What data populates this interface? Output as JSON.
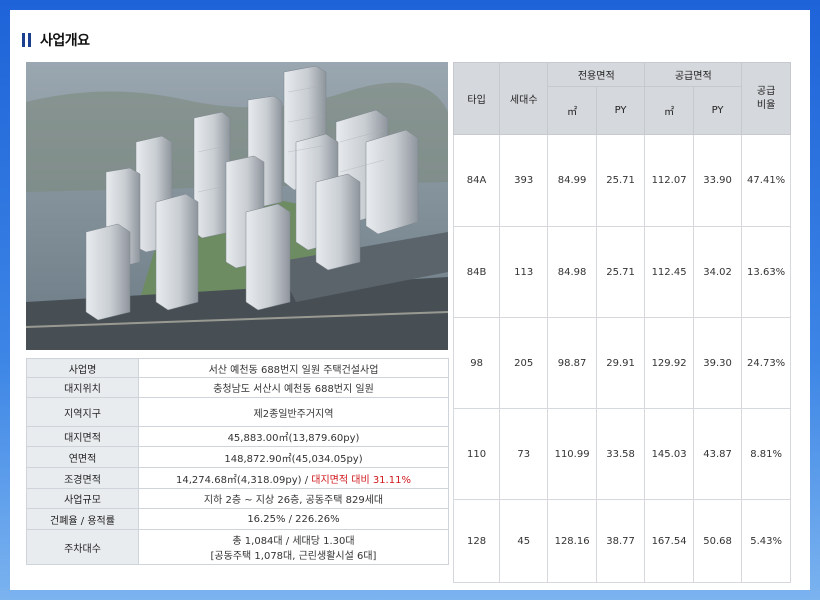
{
  "section": {
    "title": "사업개요"
  },
  "info_rows": [
    {
      "label": "사업명",
      "value": "서산 예천동 688번지 일원 주택건설사업"
    },
    {
      "label": "대지위치",
      "value": "충청남도 서산시 예천동 688번지 일원"
    },
    {
      "label": "지역지구",
      "value": "제2종일반주거지역"
    },
    {
      "label": "대지면적",
      "value": "45,883.00㎡(13,879.60py)"
    },
    {
      "label": "연면적",
      "value": "148,872.90㎡(45,034.05py)"
    },
    {
      "label": "조경면적",
      "value": "14,274.68㎡(4,318.09py) / ",
      "highlight": "대지면적 대비 31.11%"
    },
    {
      "label": "사업규모",
      "value": "지하 2층 ~ 지상 26층, 공동주택 829세대"
    },
    {
      "label": "건폐율 / 용적률",
      "value": "16.25% / 226.26%"
    },
    {
      "label": "주차대수",
      "value": "총 1,084대 / 세대당 1.30대",
      "value2": "[공동주택 1,078대, 근린생활시설 6대]"
    }
  ],
  "type_table": {
    "headers": {
      "type": "타입",
      "units": "세대수",
      "exclusive": "전용면적",
      "supply": "공급면적",
      "ratio": "공급\n비율",
      "sqm": "㎡",
      "py": "PY"
    },
    "rows": [
      {
        "type": "84A",
        "units": "393",
        "ex_sqm": "84.99",
        "ex_py": "25.71",
        "sup_sqm": "112.07",
        "sup_py": "33.90",
        "ratio": "47.41%"
      },
      {
        "type": "84B",
        "units": "113",
        "ex_sqm": "84.98",
        "ex_py": "25.71",
        "sup_sqm": "112.45",
        "sup_py": "34.02",
        "ratio": "13.63%"
      },
      {
        "type": "98",
        "units": "205",
        "ex_sqm": "98.87",
        "ex_py": "29.91",
        "sup_sqm": "129.92",
        "sup_py": "39.30",
        "ratio": "24.73%"
      },
      {
        "type": "110",
        "units": "73",
        "ex_sqm": "110.99",
        "ex_py": "33.58",
        "sup_sqm": "145.03",
        "sup_py": "43.87",
        "ratio": "8.81%"
      },
      {
        "type": "128",
        "units": "45",
        "ex_sqm": "128.16",
        "ex_py": "38.77",
        "sup_sqm": "167.54",
        "sup_py": "50.68",
        "ratio": "5.43%"
      }
    ]
  }
}
